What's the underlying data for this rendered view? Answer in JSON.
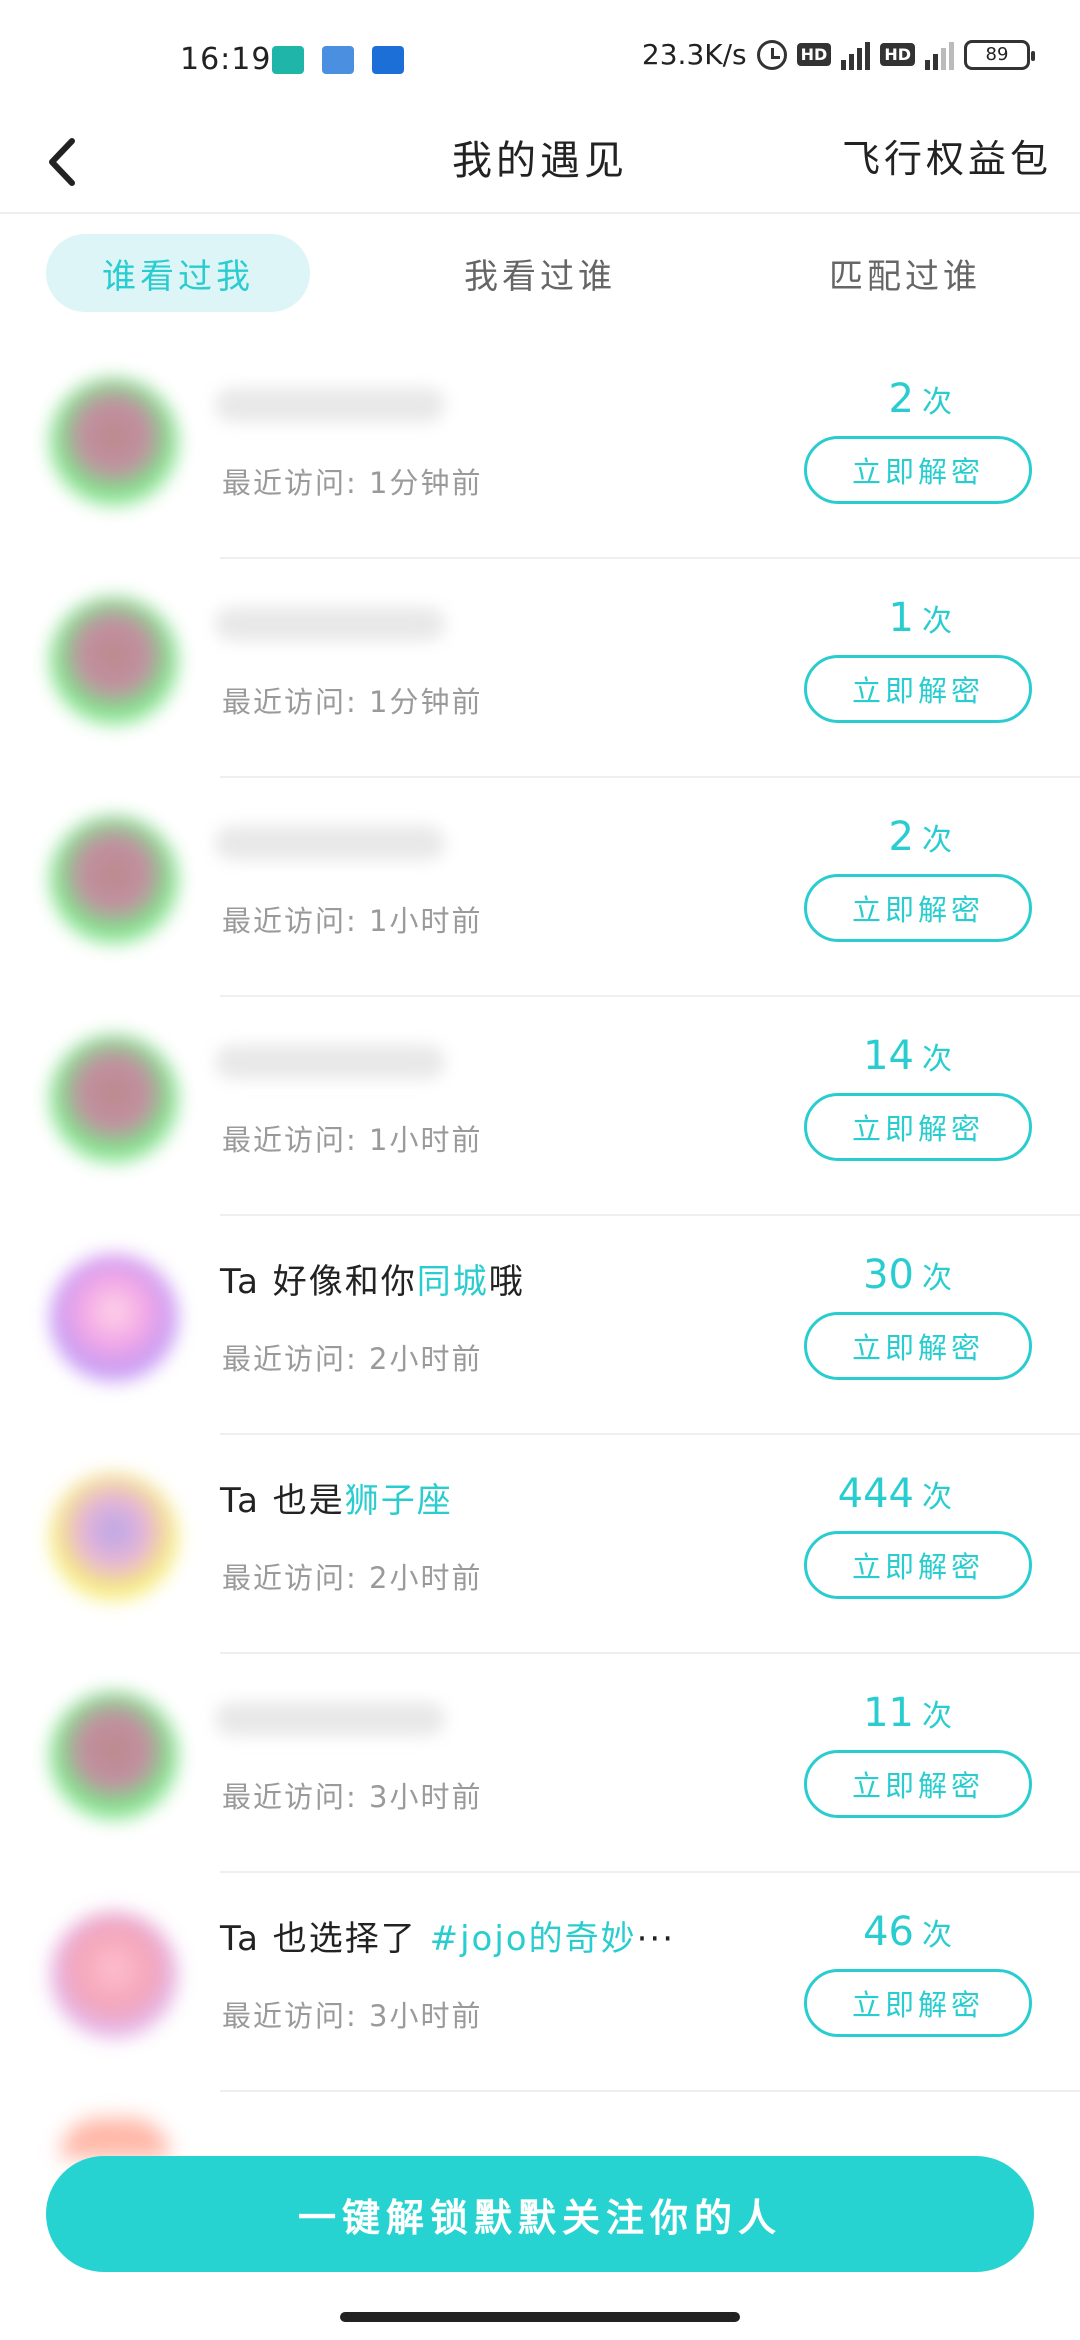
{
  "status_bar": {
    "time": "16:19",
    "net_speed": "23.3K/s",
    "hd": "HD",
    "battery": "89"
  },
  "header": {
    "title": "我的遇见",
    "right_link": "飞行权益包"
  },
  "tabs": [
    {
      "label": "谁看过我",
      "active": true
    },
    {
      "label": "我看过谁",
      "active": false
    },
    {
      "label": "匹配过谁",
      "active": false
    }
  ],
  "visitors": [
    {
      "hint_prefix": "",
      "hint_highlight": "",
      "hint_suffix": "",
      "visit": "最近访问: 1分钟前",
      "count": "2",
      "unit": "次",
      "button": "立即解密"
    },
    {
      "hint_prefix": "",
      "hint_highlight": "",
      "hint_suffix": "",
      "visit": "最近访问: 1分钟前",
      "count": "1",
      "unit": "次",
      "button": "立即解密"
    },
    {
      "hint_prefix": "",
      "hint_highlight": "",
      "hint_suffix": "",
      "visit": "最近访问: 1小时前",
      "count": "2",
      "unit": "次",
      "button": "立即解密"
    },
    {
      "hint_prefix": "",
      "hint_highlight": "",
      "hint_suffix": "",
      "visit": "最近访问: 1小时前",
      "count": "14",
      "unit": "次",
      "button": "立即解密"
    },
    {
      "hint_prefix": "Ta 好像和你",
      "hint_highlight": "同城",
      "hint_suffix": "哦",
      "visit": "最近访问: 2小时前",
      "count": "30",
      "unit": "次",
      "button": "立即解密"
    },
    {
      "hint_prefix": "Ta 也是",
      "hint_highlight": "狮子座",
      "hint_suffix": "",
      "visit": "最近访问: 2小时前",
      "count": "444",
      "unit": "次",
      "button": "立即解密"
    },
    {
      "hint_prefix": "",
      "hint_highlight": "",
      "hint_suffix": "",
      "visit": "最近访问: 3小时前",
      "count": "11",
      "unit": "次",
      "button": "立即解密"
    },
    {
      "hint_prefix": "Ta 也选择了 ",
      "hint_highlight": "#jojo的奇妙",
      "hint_suffix": "···",
      "visit": "最近访问: 3小时前",
      "count": "46",
      "unit": "次",
      "button": "立即解密"
    }
  ],
  "cta": {
    "label": "一键解锁默默关注你的人"
  },
  "colors": {
    "accent": "#2acdcf",
    "cta_bg": "#26d3d1",
    "tab_active_bg": "#def5f7"
  }
}
